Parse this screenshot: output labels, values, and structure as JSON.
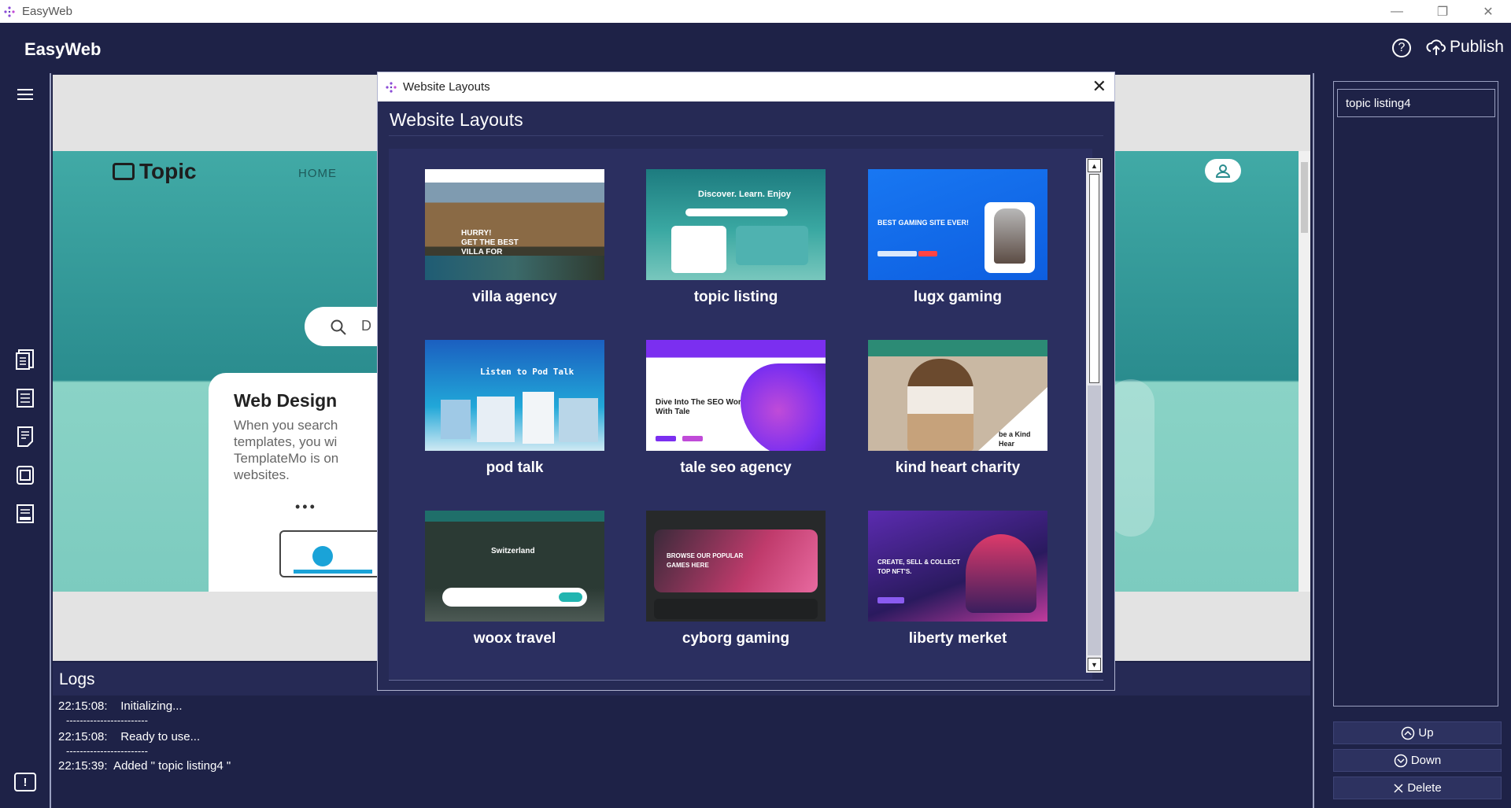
{
  "window": {
    "title": "EasyWeb",
    "minimize": "—",
    "restore": "❐",
    "close": "✕"
  },
  "header": {
    "brand": "EasyWeb",
    "help": "?",
    "publish_label": "Publish"
  },
  "left_rail": {
    "items": [
      "pages-icon",
      "list-icon",
      "document-icon",
      "layers-icon",
      "form-icon"
    ]
  },
  "preview": {
    "logo": "Topic",
    "nav_home": "HOME",
    "search_partial": "D",
    "card_title": "Web Design",
    "card_text": "When you search\ntemplates, you wi\nTemplateMo is on\nwebsites.",
    "dots": "•••"
  },
  "logs": {
    "title": "Logs",
    "entries": [
      {
        "time": "22:15:08:",
        "text": "Initializing...",
        "separator": "------------------------"
      },
      {
        "time": "22:15:08:",
        "text": "Ready to use...",
        "separator": "------------------------"
      },
      {
        "time": "22:15:39:",
        "text": "Added \" topic listing4 \"",
        "separator": ""
      }
    ]
  },
  "right_panel": {
    "items": [
      "topic listing4"
    ],
    "up_label": "Up",
    "down_label": "Down",
    "delete_label": "Delete"
  },
  "modal": {
    "window_title": "Website Layouts",
    "heading": "Website Layouts",
    "close": "✕",
    "layouts": [
      {
        "name": "villa agency",
        "thumb_text": "HURRY!\nGET THE BEST\nVILLA FOR\nYOU"
      },
      {
        "name": "topic listing",
        "thumb_text": "Discover. Learn. Enjoy"
      },
      {
        "name": "lugx gaming",
        "thumb_text": "BEST GAMING SITE EVER!"
      },
      {
        "name": "pod talk",
        "thumb_text": "Listen to Pod Talk"
      },
      {
        "name": "tale seo agency",
        "thumb_text": "Dive Into The SEO World\nWith Tale"
      },
      {
        "name": "kind heart charity",
        "thumb_text": "be a Kind Hear"
      },
      {
        "name": "woox travel",
        "thumb_text": "Switzerland"
      },
      {
        "name": "cyborg gaming",
        "thumb_text": "BROWSE OUR POPULAR\nGAMES HERE"
      },
      {
        "name": "liberty merket",
        "thumb_text": "CREATE, SELL & COLLECT\nTOP NFT'S."
      }
    ]
  },
  "colors": {
    "app_bg": "#1e2247",
    "panel_bg": "#262a55",
    "border": "#9aa0c0",
    "preview_teal": "#41aaa6"
  }
}
